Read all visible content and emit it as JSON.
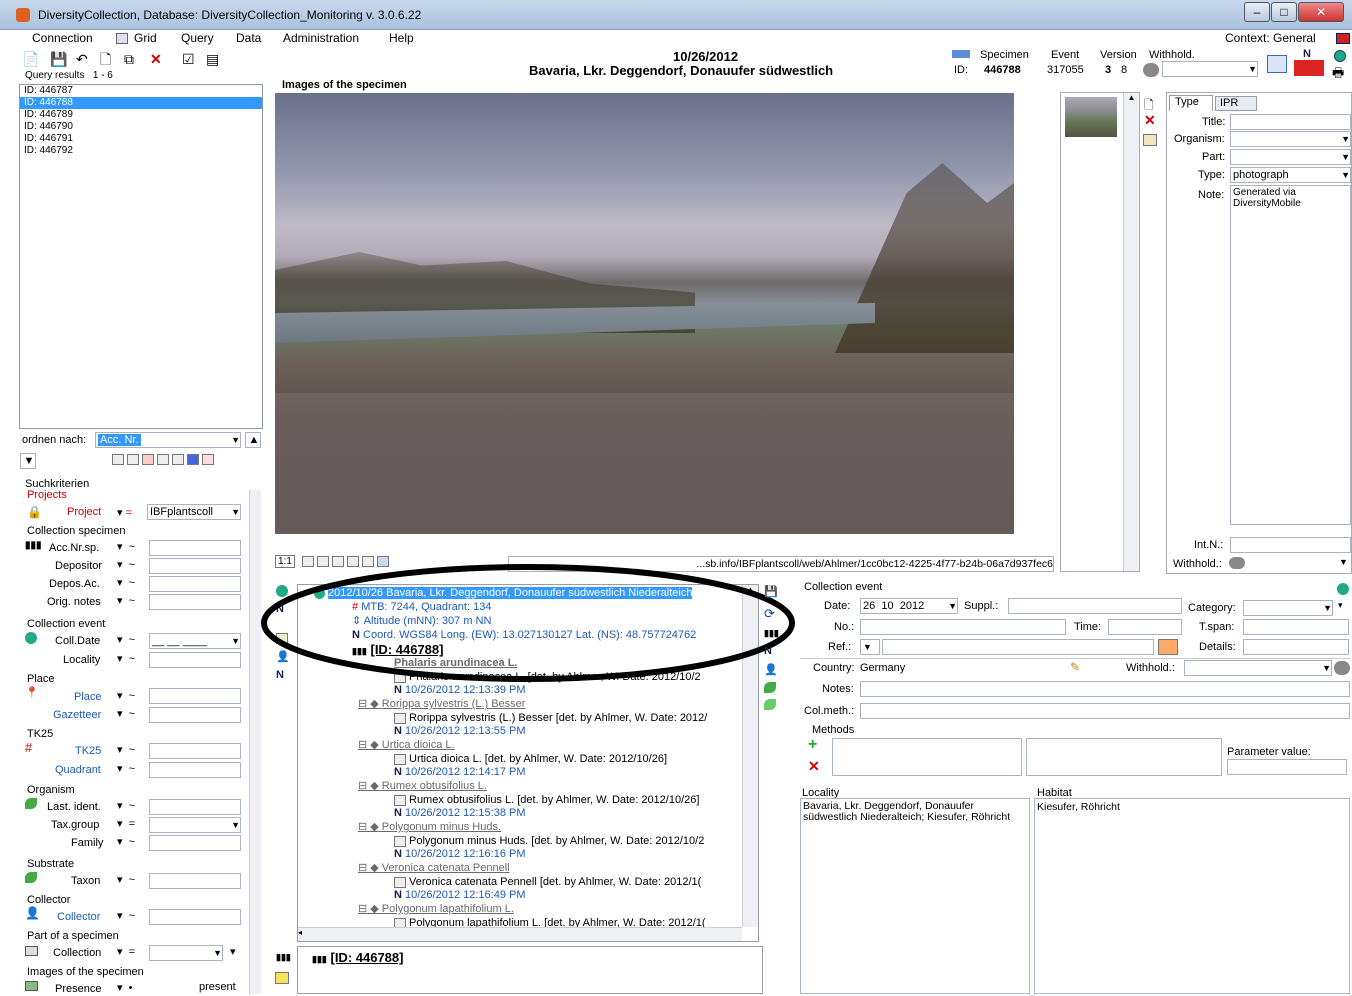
{
  "window": {
    "title": "DiversityCollection,  Database: DiversityCollection_Monitoring    v. 3.0.6.22",
    "context": "Context: General"
  },
  "menu": [
    "Connection",
    "Grid",
    "Query",
    "Data",
    "Administration",
    "Help"
  ],
  "header": {
    "date": "10/26/2012",
    "locality": "Bavaria, Lkr. Deggendorf, Donauufer südwestlich",
    "specimen_label": "Specimen",
    "event_label": "Event",
    "version_label": "Version",
    "withhold_label": "Withhold.",
    "id_label": "ID:",
    "specimen_id": "446788",
    "event_id": "317055",
    "version_a": "3",
    "version_b": "8"
  },
  "query": {
    "label": "Query results",
    "range": "1 - 6",
    "items": [
      "ID: 446787",
      "ID: 446788",
      "ID: 446789",
      "ID: 446790",
      "ID: 446791",
      "ID: 446792"
    ],
    "order_label": "ordnen nach:",
    "order_value": "Acc. Nr."
  },
  "criteria": {
    "title": "Suchkriterien",
    "projects": "Projects",
    "project": "Project",
    "project_value": "IBFplantscoll",
    "collection_specimen": "Collection specimen",
    "acc": "Acc.Nr.sp.",
    "depositor": "Depositor",
    "depos_ac": "Depos.Ac.",
    "orig_notes": "Orig. notes",
    "collection_event": "Collection event",
    "coll_date": "Coll.Date",
    "locality": "Locality",
    "place_h": "Place",
    "place": "Place",
    "gazetteer": "Gazetteer",
    "tk25_h": "TK25",
    "tk25": "TK25",
    "quadrant": "Quadrant",
    "organism": "Organism",
    "last_ident": "Last. ident.",
    "tax_group": "Tax.group",
    "family": "Family",
    "substrate": "Substrate",
    "taxon": "Taxon",
    "collector_h": "Collector",
    "collector": "Collector",
    "part": "Part of a specimen",
    "collection": "Collection",
    "images": "Images of the specimen",
    "presence": "Presence",
    "present": "present",
    "tilde": "~",
    "eq": "="
  },
  "images": {
    "title": "Images of the specimen",
    "url": "...sb.info/IBFplantscoll/web/Ahlmer/1cc0bc12-4225-4f77-b24b-06a7d937fec6",
    "zoom": "1:1"
  },
  "props": {
    "tab_type": "Type",
    "tab_ipr": "IPR",
    "title": "Title:",
    "organism": "Organism:",
    "part": "Part:",
    "type": "Type:",
    "type_value": "photograph",
    "note": "Note:",
    "note_value": "Generated via DiversityMobile",
    "intn": "Int.N.:",
    "withhold": "Withhold.:"
  },
  "tree": {
    "root": "2012/10/26 Bavaria, Lkr. Deggendorf, Donauufer südwestlich Niederalteich",
    "mtb": "MTB: 7244, Quadrant: 134",
    "alt": "Altitude (mNN): 307 m NN",
    "coord": "Coord. WGS84 Long. (EW): 13.027130127 Lat. (NS): 48.757724762",
    "id": "[ID: 446788]",
    "taxa": [
      {
        "name": "Phalaris arundinacea L.",
        "ident": "Phalaris arundinacea L.   [det. by Ahlmer, W.   Date: 2012/10/2",
        "time": "10/26/2012 12:13:39 PM"
      },
      {
        "name": "Rorippa sylvestris (L.) Besser",
        "ident": "Rorippa sylvestris (L.) Besser   [det. by Ahlmer, W.   Date: 2012/",
        "time": "10/26/2012 12:13:55 PM"
      },
      {
        "name": "Urtica dioica L.",
        "ident": "Urtica dioica L.   [det. by Ahlmer, W.   Date: 2012/10/26]",
        "time": "10/26/2012 12:14:17 PM"
      },
      {
        "name": "Rumex obtusifolius L.",
        "ident": "Rumex obtusifolius L.   [det. by Ahlmer, W.   Date: 2012/10/26]",
        "time": "10/26/2012 12:15:38 PM"
      },
      {
        "name": "Polygonum minus Huds.",
        "ident": "Polygonum minus Huds.   [det. by Ahlmer, W.   Date: 2012/10/2",
        "time": "10/26/2012 12:16:16 PM"
      },
      {
        "name": "Veronica catenata Pennell",
        "ident": "Veronica catenata Pennell   [det. by Ahlmer, W.   Date: 2012/1(",
        "time": "10/26/2012 12:16:49 PM"
      },
      {
        "name": "Polygonum lapathifolium L.",
        "ident": "Polygonum lapathifolium L.   [det. by Ahlmer, W.   Date: 2012/1("
      }
    ],
    "bottom_id": "[ID: 446788]"
  },
  "event": {
    "title": "Collection event",
    "date_label": "Date:",
    "day": "26",
    "month": "10",
    "year": "2012",
    "suppl": "Suppl.:",
    "category": "Category:",
    "no": "No.:",
    "time": "Time:",
    "tspan": "T.span:",
    "ref": "Ref.:",
    "details": "Details:",
    "country_label": "Country:",
    "country": "Germany",
    "withhold": "Withhold.:",
    "notes": "Notes:",
    "colmeth": "Col.meth.:",
    "methods": "Methods",
    "param": "Parameter value:",
    "locality_label": "Locality",
    "locality": "Bavaria, Lkr. Deggendorf, Donauufer südwestlich Niederalteich; Kiesufer, Röhricht",
    "habitat_label": "Habitat",
    "habitat": "Kiesufer, Röhricht"
  }
}
